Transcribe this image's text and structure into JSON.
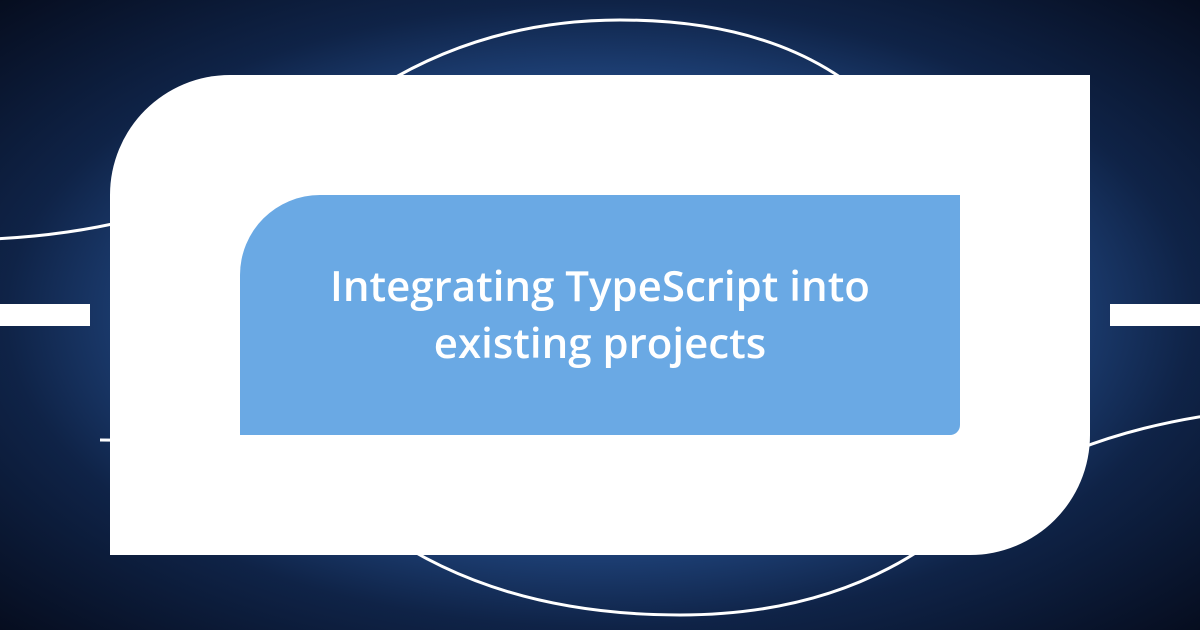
{
  "title": "Integrating TypeScript into existing projects"
}
